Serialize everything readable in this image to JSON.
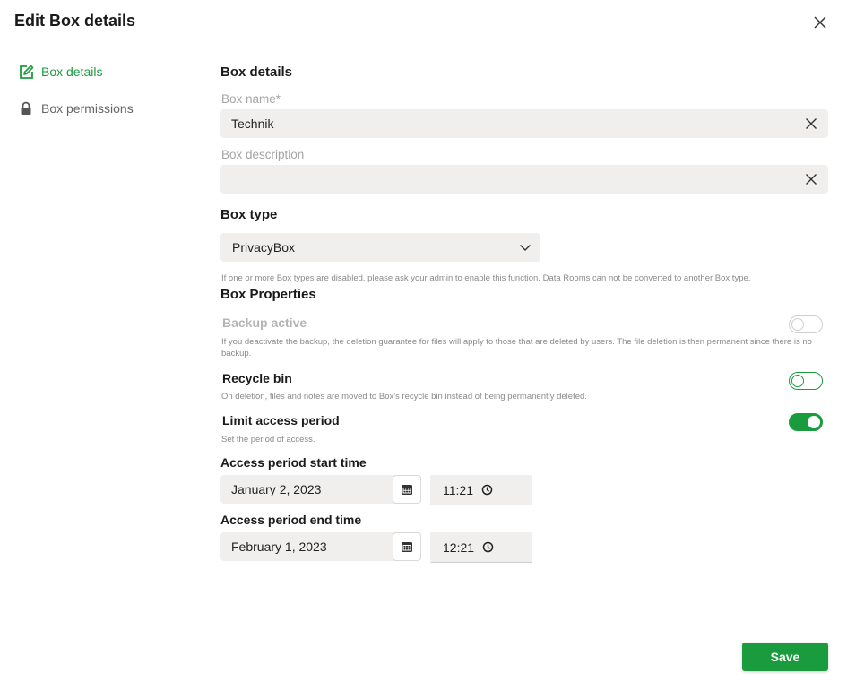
{
  "dialog": {
    "title": "Edit Box details"
  },
  "sidebar": {
    "items": [
      {
        "label": "Box details",
        "icon": "edit-icon",
        "active": true
      },
      {
        "label": "Box permissions",
        "icon": "lock-icon",
        "active": false
      }
    ]
  },
  "details": {
    "section_title": "Box details",
    "box_name_label": "Box name*",
    "box_name_value": "Technik",
    "box_description_label": "Box description",
    "box_description_value": ""
  },
  "box_type": {
    "section_title": "Box type",
    "selected": "PrivacyBox",
    "hint": "If one or more Box types are disabled, please ask your admin to enable this function. Data Rooms can not be converted to another Box type."
  },
  "properties": {
    "section_title": "Box Properties",
    "backup": {
      "label": "Backup active",
      "hint": "If you deactivate the backup, the deletion guarantee for files will apply to those that are deleted by users. The file deletion is then permanent since there is no backup.",
      "enabled": false,
      "disabled": true
    },
    "recycle_bin": {
      "label": "Recycle bin",
      "hint": "On deletion, files and notes are moved to Box's recycle bin instead of being permanently deleted.",
      "enabled": false
    },
    "limit_access": {
      "label": "Limit access period",
      "hint": "Set the period of access.",
      "enabled": true
    }
  },
  "access_period": {
    "start_title": "Access period start time",
    "start_date": "January 2, 2023",
    "start_time": "11:21",
    "end_title": "Access period end time",
    "end_date": "February 1, 2023",
    "end_time": "12:21"
  },
  "footer": {
    "save_label": "Save"
  },
  "colors": {
    "accent": "#1a9c3e",
    "field_bg": "#f0efee"
  }
}
